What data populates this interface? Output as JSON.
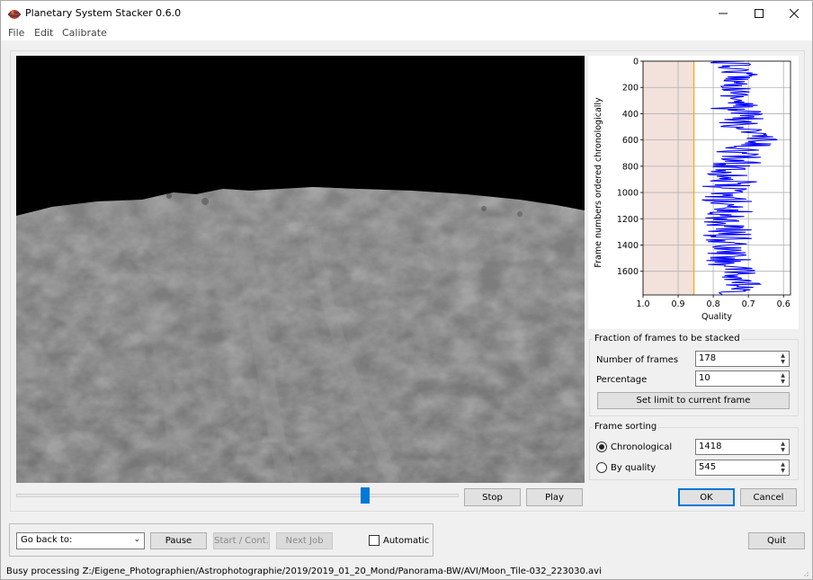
{
  "window": {
    "title": "Planetary System Stacker 0.6.0"
  },
  "menu": [
    "File",
    "Edit",
    "Calibrate"
  ],
  "chart_data": {
    "type": "line",
    "xlabel": "Quality",
    "ylabel": "Frame numbers ordered chronologically",
    "xlim": [
      1.0,
      0.58
    ],
    "ylim": [
      1780,
      0
    ],
    "xticks": [
      "1.0",
      "0.9",
      "0.8",
      "0.7",
      "0.6"
    ],
    "yticks": [
      "0",
      "200",
      "400",
      "600",
      "800",
      "1000",
      "1200",
      "1400",
      "1600"
    ],
    "grid": true,
    "cutoff_quality": 0.855,
    "series": [
      {
        "color": "#0000ff",
        "frames": [
          0,
          100,
          200,
          300,
          400,
          500,
          560,
          620,
          700,
          800,
          900,
          1000,
          1100,
          1200,
          1300,
          1400,
          1500,
          1600,
          1700,
          1780
        ],
        "quality_min": [
          0.82,
          0.77,
          0.78,
          0.78,
          0.84,
          0.78,
          0.73,
          0.75,
          0.8,
          0.82,
          0.83,
          0.85,
          0.82,
          0.84,
          0.83,
          0.84,
          0.83,
          0.81,
          0.78,
          0.81
        ],
        "quality_max": [
          0.7,
          0.67,
          0.69,
          0.68,
          0.64,
          0.65,
          0.61,
          0.62,
          0.66,
          0.66,
          0.67,
          0.7,
          0.68,
          0.69,
          0.68,
          0.7,
          0.69,
          0.68,
          0.66,
          0.72
        ]
      }
    ],
    "colors": {
      "selected_band": "#f3e1dc",
      "cutoff_line": "#ffa500",
      "trace": "#0000ff"
    }
  },
  "fraction": {
    "title": "Fraction of frames to be stacked",
    "frames_label": "Number of frames",
    "frames_value": "178",
    "percentage_label": "Percentage",
    "percentage_value": "10",
    "set_limit_label": "Set limit to current frame"
  },
  "sorting": {
    "title": "Frame sorting",
    "chronological_label": "Chronological",
    "chronological_value": "1418",
    "chronological_selected": true,
    "quality_label": "By quality",
    "quality_value": "545"
  },
  "playback": {
    "stop_label": "Stop",
    "play_label": "Play",
    "slider_value": 0.78
  },
  "dialog": {
    "ok_label": "OK",
    "cancel_label": "Cancel"
  },
  "workflow": {
    "go_back_value": "Go back to:",
    "pause_label": "Pause",
    "start_label": "Start / Cont.",
    "next_job_label": "Next Job",
    "automatic_label": "Automatic",
    "automatic_checked": false
  },
  "quit_label": "Quit",
  "status": "Busy processing Z:/Eigene_Photographien/Astrophotographie/2019/2019_01_20_Mond/Panorama-BW/AVI/Moon_Tile-032_223030.avi"
}
